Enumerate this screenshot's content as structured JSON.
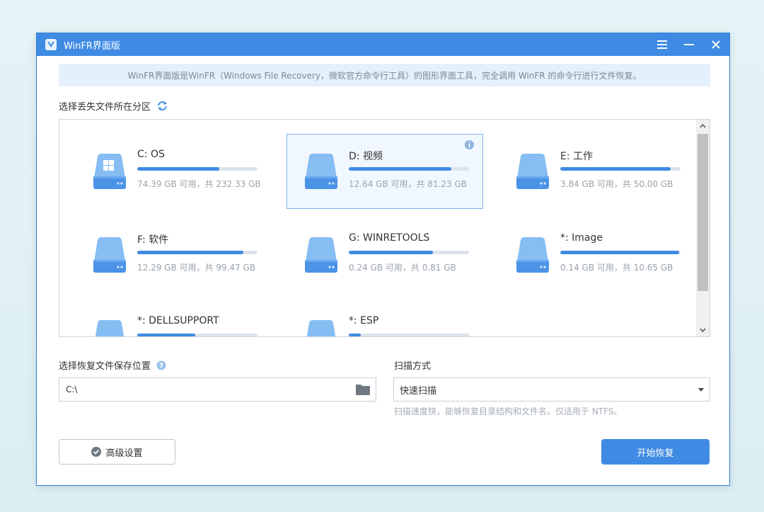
{
  "window": {
    "title": "WinFR界面版"
  },
  "banner": {
    "text": "WinFR界面版是WinFR（Windows File Recovery，微软官方命令行工具）的图形界面工具，完全调用 WinFR 的命令行进行文件恢复。"
  },
  "partition_section": {
    "label": "选择丢失文件所在分区"
  },
  "drives": [
    {
      "name": "C: OS",
      "size": "74.39 GB 可用，共 232.33 GB",
      "used_fraction": 0.68,
      "icon": "windows-drive-icon",
      "selected": false
    },
    {
      "name": "D: 视频",
      "size": "12.64 GB 可用，共 81.23 GB",
      "used_fraction": 0.85,
      "icon": "drive-icon",
      "selected": true
    },
    {
      "name": "E: 工作",
      "size": "3.84 GB 可用，共 50.00 GB",
      "used_fraction": 0.92,
      "icon": "drive-icon",
      "selected": false
    },
    {
      "name": "F: 软件",
      "size": "12.29 GB 可用，共 99.47 GB",
      "used_fraction": 0.88,
      "icon": "drive-icon",
      "selected": false
    },
    {
      "name": "G: WINRETOOLS",
      "size": "0.24 GB 可用，共 0.81 GB",
      "used_fraction": 0.7,
      "icon": "drive-icon",
      "selected": false
    },
    {
      "name": "*: Image",
      "size": "0.14 GB 可用，共 10.65 GB",
      "used_fraction": 0.99,
      "icon": "drive-icon",
      "selected": false
    },
    {
      "name": "*: DELLSUPPORT",
      "size": "",
      "used_fraction": 0.48,
      "icon": "drive-icon",
      "selected": false
    },
    {
      "name": "*: ESP",
      "size": "",
      "used_fraction": 0.1,
      "icon": "drive-icon",
      "selected": false
    }
  ],
  "save_section": {
    "label": "选择恢复文件保存位置",
    "path_value": "C:\\"
  },
  "scan_section": {
    "label": "扫描方式",
    "selected": "快速扫描",
    "hint": "扫描速度快，能够恢复目录结构和文件名。仅适用于 NTFS。"
  },
  "buttons": {
    "advanced": "高级设置",
    "start": "开始恢复"
  },
  "colors": {
    "accent": "#3f8be3",
    "titlebar": "#3f8be3",
    "banner_bg": "#e4f0fb",
    "drive_icon": "#5aa0ea"
  }
}
